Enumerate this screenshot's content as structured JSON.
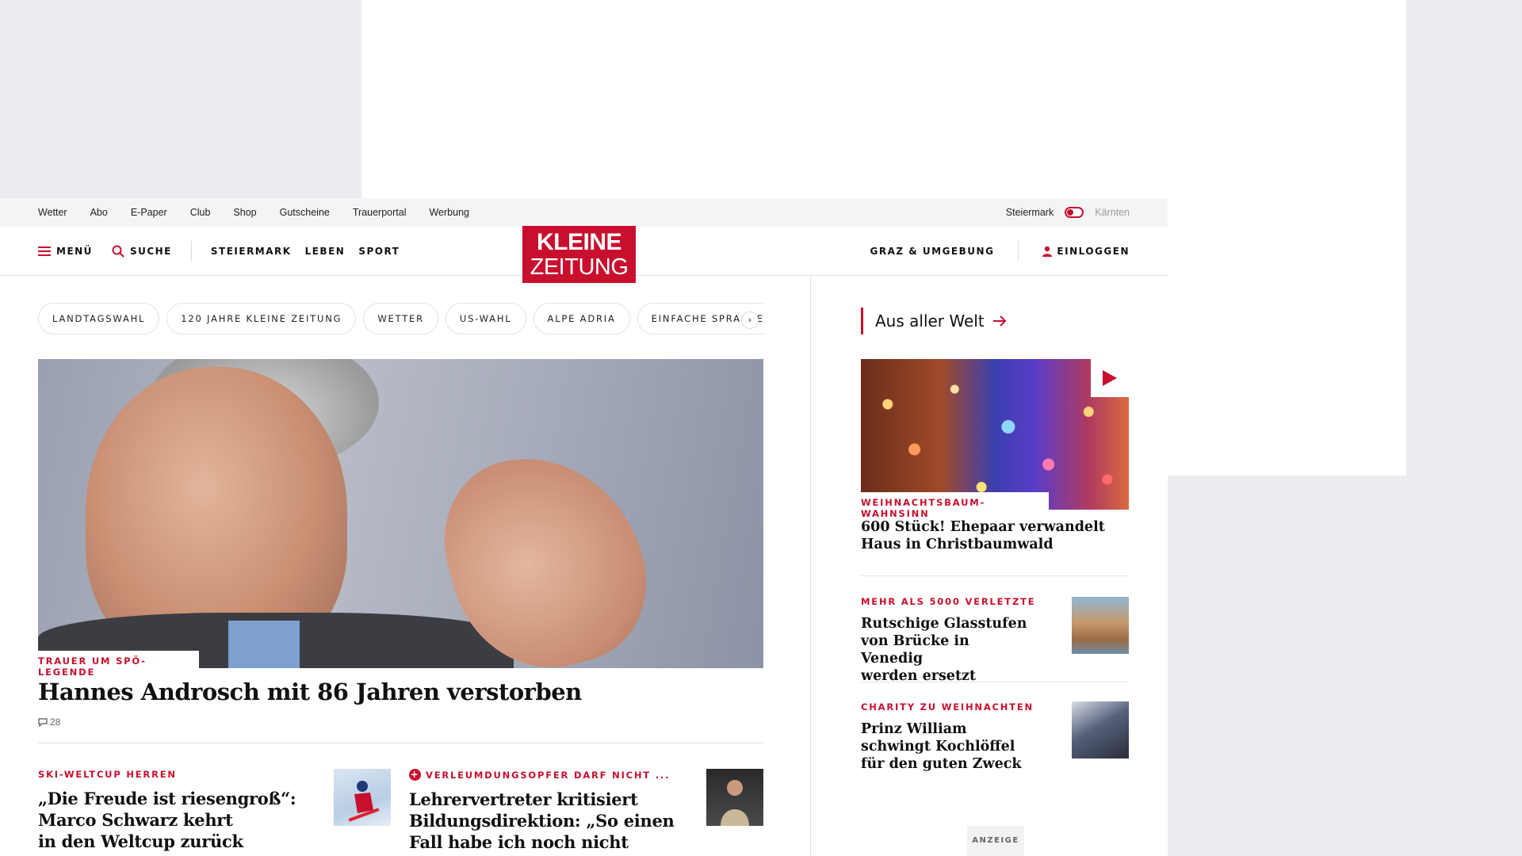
{
  "topbar": {
    "links": [
      "Wetter",
      "Abo",
      "E-Paper",
      "Club",
      "Shop",
      "Gutscheine",
      "Trauerportal",
      "Werbung"
    ],
    "region_active": "Steiermark",
    "region_inactive": "Kärnten"
  },
  "nav": {
    "menu": "MENÜ",
    "search": "SUCHE",
    "sections": [
      "STEIERMARK",
      "LEBEN",
      "SPORT"
    ],
    "local": "GRAZ & UMGEBUNG",
    "login": "EINLOGGEN"
  },
  "logo": {
    "line1": "KLEINE",
    "line2": "ZEITUNG"
  },
  "tags": [
    "LANDTAGSWAHL",
    "120 JAHRE KLEINE ZEITUNG",
    "WETTER",
    "US-WAHL",
    "ALPE ADRIA",
    "EINFACHE SPRACHE"
  ],
  "tags_next": "›",
  "hero": {
    "kicker": "TRAUER UM SPÖ-LEGENDE",
    "title": "Hannes Androsch mit 86 Jahren verstorben",
    "comments": "28"
  },
  "sub_articles": [
    {
      "kicker": "SKI-WELTCUP HERREN",
      "title_lines": [
        "„Die Freude ist riesengroß“:",
        "Marco Schwarz kehrt",
        "in den Weltcup zurück"
      ]
    },
    {
      "kicker": "VERLEUMDUNGSOPFER DARF NICHT ...",
      "title_lines": [
        "Lehrervertreter kritisiert",
        "Bildungsdirektion: „So einen",
        "Fall habe ich noch nicht erlebt“"
      ],
      "premium": "+"
    }
  ],
  "sidebar": {
    "heading": "Aus aller Welt",
    "featured": {
      "kicker": "WEIHNACHTSBAUM-WAHNSINN",
      "title_lines": [
        "600 Stück! Ehepaar verwandelt",
        "Haus in Christbaumwald"
      ]
    },
    "items": [
      {
        "kicker": "MEHR ALS 5000 VERLETZTE",
        "title_lines": [
          "Rutschige Glasstufen",
          "von Brücke in Venedig",
          "werden ersetzt"
        ]
      },
      {
        "kicker": "CHARITY ZU WEIHNACHTEN",
        "title_lines": [
          "Prinz William",
          "schwingt Kochlöffel",
          "für den guten Zweck"
        ]
      }
    ],
    "ad_label": "ANZEIGE"
  },
  "colors": {
    "brand": "#c8102e",
    "ad_blue": "#0a8fd6",
    "ad_gray": "#717171"
  }
}
